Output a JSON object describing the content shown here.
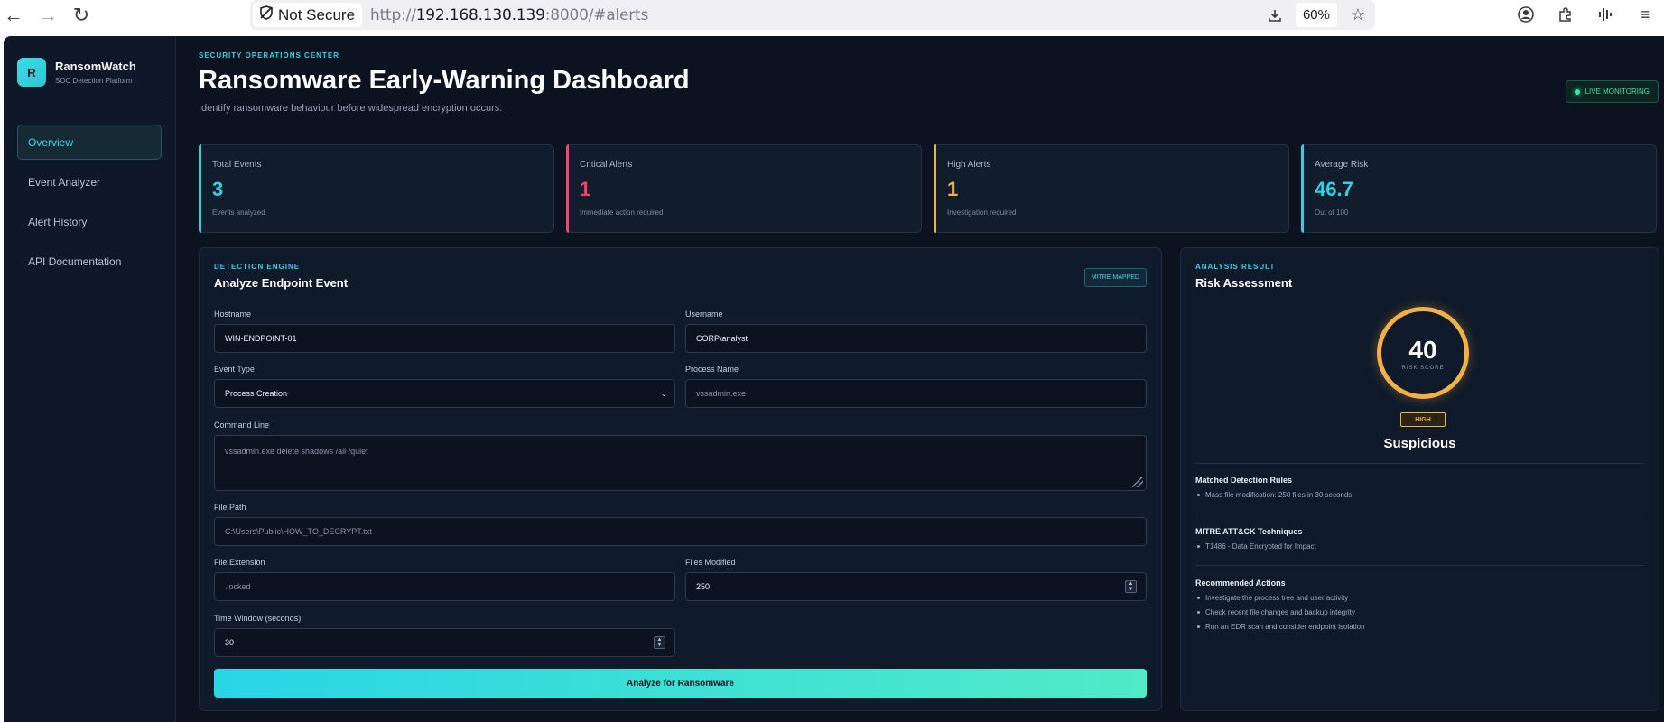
{
  "browser": {
    "security_label": "Not Secure",
    "url_scheme": "http://",
    "url_host": "192.168.130.139",
    "url_rest": ":8000/#alerts",
    "zoom": "60%"
  },
  "sidebar": {
    "logo_letter": "R",
    "brand_name": "RansomWatch",
    "brand_subtitle": "SOC Detection Platform",
    "items": [
      {
        "label": "Overview",
        "active": true
      },
      {
        "label": "Event Analyzer"
      },
      {
        "label": "Alert History"
      },
      {
        "label": "API Documentation"
      }
    ]
  },
  "header": {
    "eyebrow": "SECURITY OPERATIONS CENTER",
    "title": "Ransomware Early-Warning Dashboard",
    "description": "Identify ransomware behaviour before widespread encryption occurs.",
    "live_badge": "LIVE MONITORING"
  },
  "stats": [
    {
      "label": "Total Events",
      "value": "3",
      "sub": "Events analyzed",
      "color": "#2fd2e2"
    },
    {
      "label": "Critical Alerts",
      "value": "1",
      "sub": "Immediate action required",
      "color": "#f2456a"
    },
    {
      "label": "High Alerts",
      "value": "1",
      "sub": "Investigation required",
      "color": "#f4b046"
    },
    {
      "label": "Average Risk",
      "value": "46.7",
      "sub": "Out of 100",
      "color": "#2fd2e2"
    }
  ],
  "form": {
    "eyebrow": "DETECTION ENGINE",
    "title": "Analyze Endpoint Event",
    "badge": "MITRE MAPPED",
    "hostname": {
      "label": "Hostname",
      "value": "WIN-ENDPOINT-01"
    },
    "username": {
      "label": "Username",
      "value": "CORP\\analyst"
    },
    "event_type": {
      "label": "Event Type",
      "value": "Process Creation"
    },
    "process_name": {
      "label": "Process Name",
      "placeholder": "vssadmin.exe"
    },
    "command_line": {
      "label": "Command Line",
      "placeholder": "vssadmin.exe delete shadows /all /quiet"
    },
    "file_path": {
      "label": "File Path",
      "placeholder": "C:\\Users\\Public\\HOW_TO_DECRYPT.txt"
    },
    "file_extension": {
      "label": "File Extension",
      "placeholder": ".locked"
    },
    "files_modified": {
      "label": "Files Modified",
      "value": "250"
    },
    "time_window": {
      "label": "Time Window (seconds)",
      "value": "30"
    },
    "submit_label": "Analyze for Ransomware"
  },
  "result": {
    "eyebrow": "ANALYSIS RESULT",
    "title": "Risk Assessment",
    "score": "40",
    "score_label": "RISK SCORE",
    "severity": "HIGH",
    "verdict": "Suspicious",
    "matched_rules": {
      "heading": "Matched Detection Rules",
      "items": [
        "Mass file modification: 250 files in 30 seconds"
      ]
    },
    "mitre": {
      "heading": "MITRE ATT&CK Techniques",
      "items": [
        "T1486 - Data Encrypted for Impact"
      ]
    },
    "actions": {
      "heading": "Recommended Actions",
      "items": [
        "Investigate the process tree and user activity",
        "Check recent file changes and backup integrity",
        "Run an EDR scan and consider endpoint isolation"
      ]
    }
  }
}
